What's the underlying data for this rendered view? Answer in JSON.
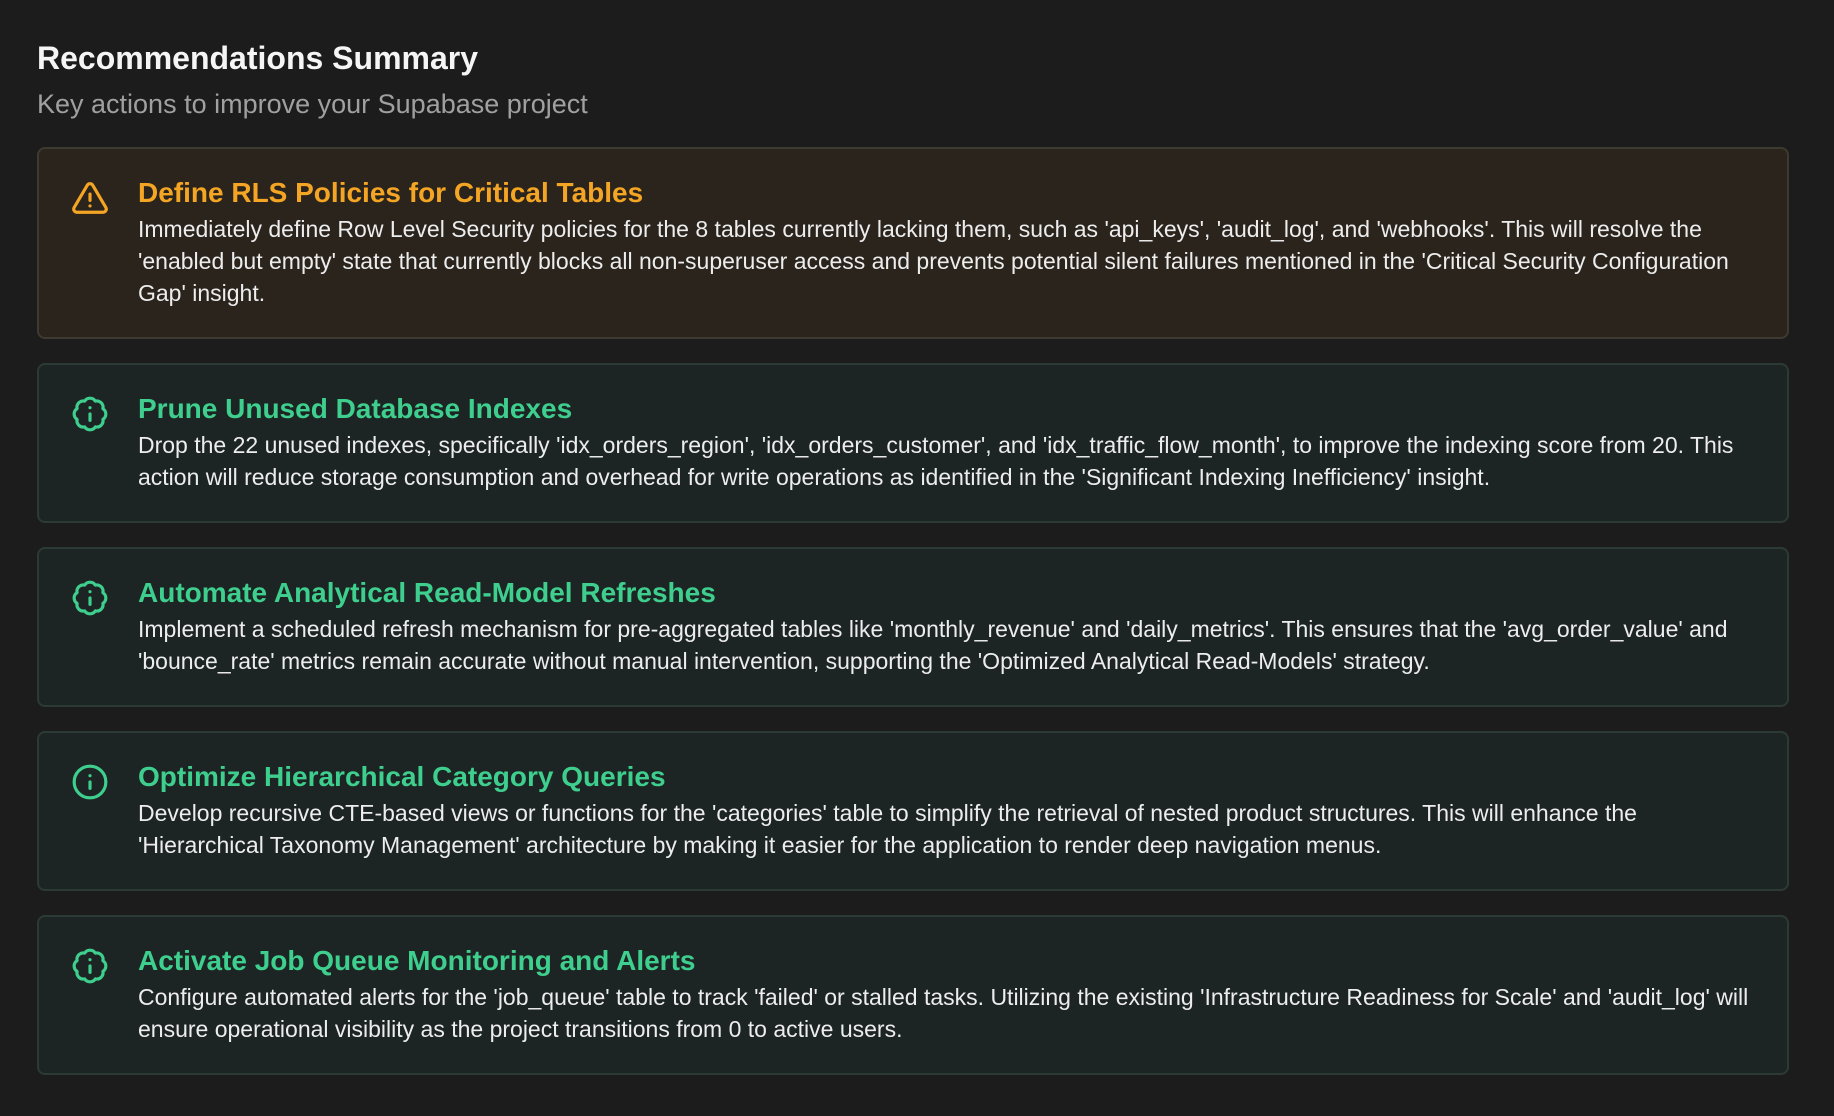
{
  "header": {
    "title": "Recommendations Summary",
    "subtitle": "Key actions to improve your Supabase project"
  },
  "colors": {
    "warning": "#f5a524",
    "info": "#3ecf8e",
    "background": "#1c1c1c"
  },
  "recommendations": [
    {
      "severity": "warning",
      "icon": "warning-triangle-icon",
      "title": "Define RLS Policies for Critical Tables",
      "text": "Immediately define Row Level Security policies for the 8 tables currently lacking them, such as 'api_keys', 'audit_log', and 'webhooks'. This will resolve the 'enabled but empty' state that currently blocks all non-superuser access and prevents potential silent failures mentioned in the 'Critical Security Configuration Gap' insight."
    },
    {
      "severity": "info",
      "icon": "info-badge-icon",
      "title": "Prune Unused Database Indexes",
      "text": "Drop the 22 unused indexes, specifically 'idx_orders_region', 'idx_orders_customer', and 'idx_traffic_flow_month', to improve the indexing score from 20. This action will reduce storage consumption and overhead for write operations as identified in the 'Significant Indexing Inefficiency' insight."
    },
    {
      "severity": "info",
      "icon": "info-badge-icon",
      "title": "Automate Analytical Read-Model Refreshes",
      "text": "Implement a scheduled refresh mechanism for pre-aggregated tables like 'monthly_revenue' and 'daily_metrics'. This ensures that the 'avg_order_value' and 'bounce_rate' metrics remain accurate without manual intervention, supporting the 'Optimized Analytical Read-Models' strategy."
    },
    {
      "severity": "info",
      "icon": "info-circle-icon",
      "title": "Optimize Hierarchical Category Queries",
      "text": "Develop recursive CTE-based views or functions for the 'categories' table to simplify the retrieval of nested product structures. This will enhance the 'Hierarchical Taxonomy Management' architecture by making it easier for the application to render deep navigation menus."
    },
    {
      "severity": "info",
      "icon": "info-badge-icon",
      "title": "Activate Job Queue Monitoring and Alerts",
      "text": "Configure automated alerts for the 'job_queue' table to track 'failed' or stalled tasks. Utilizing the existing 'Infrastructure Readiness for Scale' and 'audit_log' will ensure operational visibility as the project transitions from 0 to active users."
    }
  ]
}
